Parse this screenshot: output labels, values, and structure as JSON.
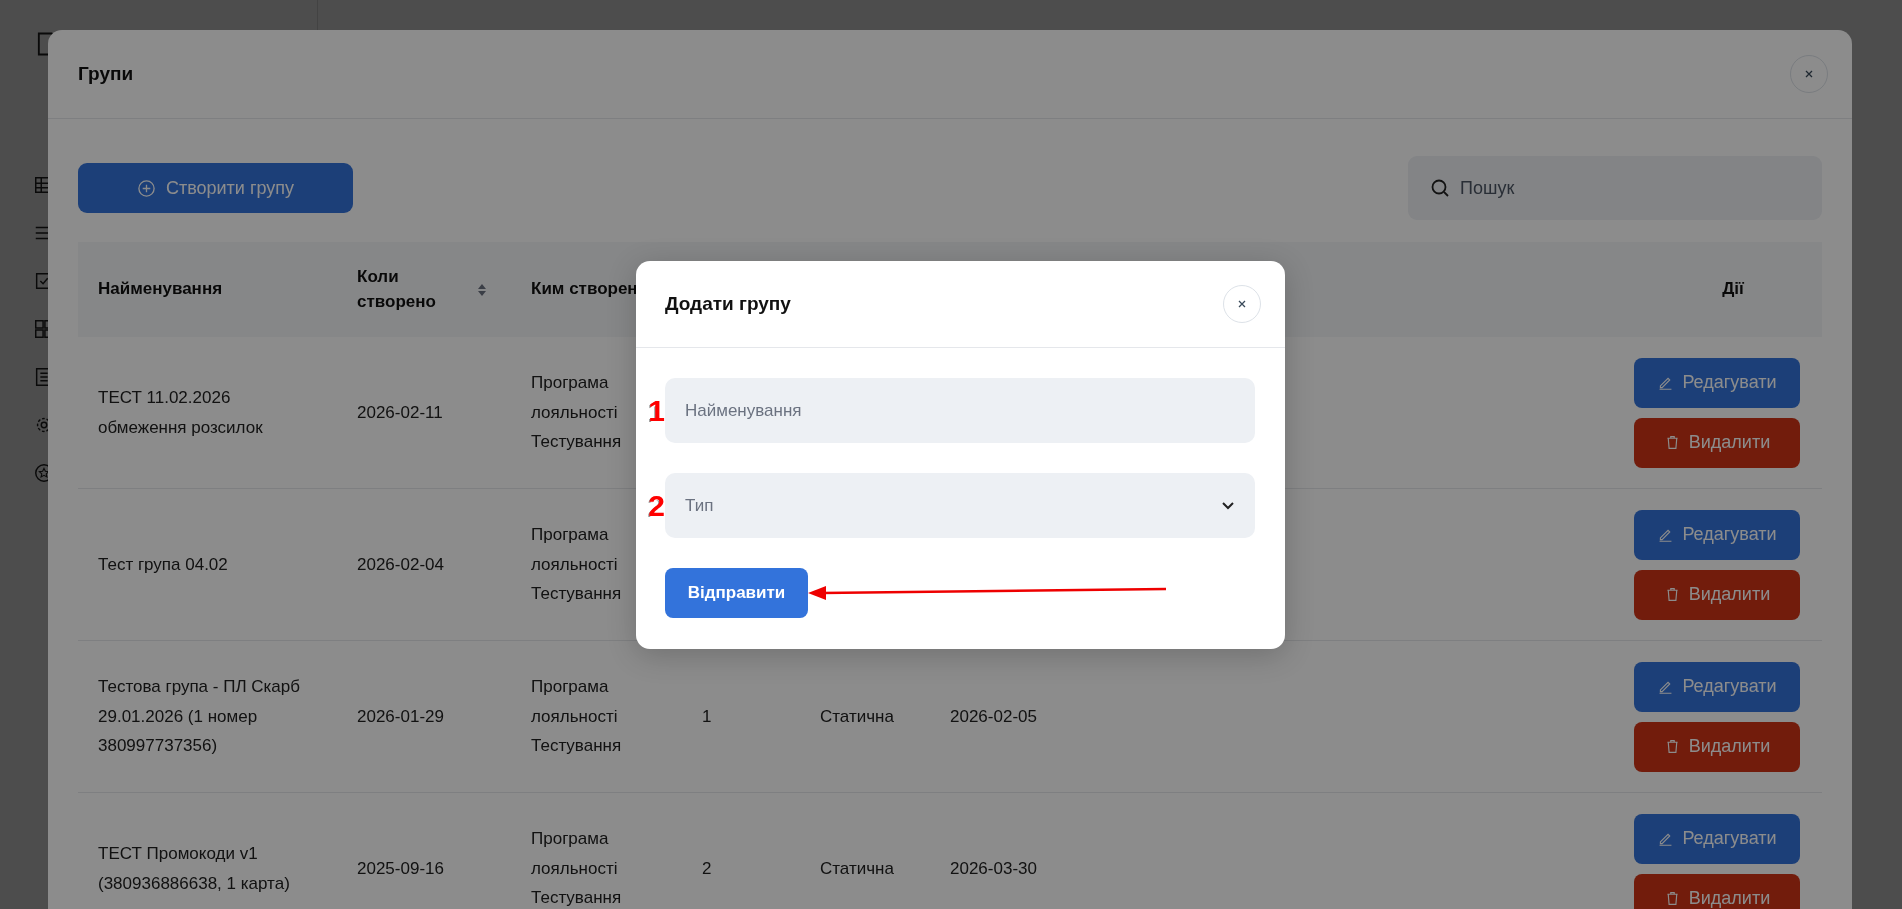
{
  "groups_dialog": {
    "title": "Групи",
    "create_button": "Створити групу",
    "search": {
      "placeholder": "Пошук"
    },
    "columns": [
      {
        "label": "Найменування"
      },
      {
        "label": "Коли створено",
        "sortable": true
      },
      {
        "label": "Ким створен"
      }
    ],
    "actions_column": "Дії",
    "rows": [
      {
        "name": "ТЕСТ 11.02.2026 обмеження розсилок",
        "created": "2026-02-11",
        "author": "Програма лояльності Тестування",
        "count": "",
        "type": "",
        "date": "",
        "edit": "Редагувати",
        "delete": "Видалити"
      },
      {
        "name": "Тест група 04.02",
        "created": "2026-02-04",
        "author": "Програма лояльності Тестування",
        "count": "",
        "type": "",
        "date": "",
        "edit": "Редагувати",
        "delete": "Видалити"
      },
      {
        "name": "Тестова група - ПЛ Скарб 29.01.2026 (1 номер 380997737356)",
        "created": "2026-01-29",
        "author": "Програма лояльності Тестування",
        "count": "1",
        "type": "Статична",
        "date": "2026-02-05",
        "edit": "Редагувати",
        "delete": "Видалити"
      },
      {
        "name": "ТЕСТ Промокоди v1 (380936886638, 1 карта)",
        "created": "2025-09-16",
        "author": "Програма лояльності Тестування",
        "count": "2",
        "type": "Статична",
        "date": "2026-03-30",
        "edit": "Редагувати",
        "delete": "Видалити"
      }
    ]
  },
  "add_group_dialog": {
    "title": "Додати групу",
    "fields": [
      {
        "kind": "text",
        "placeholder": "Найменування",
        "marker": "1"
      },
      {
        "kind": "select",
        "placeholder": "Тип",
        "marker": "2"
      }
    ],
    "submit": "Відправити"
  }
}
